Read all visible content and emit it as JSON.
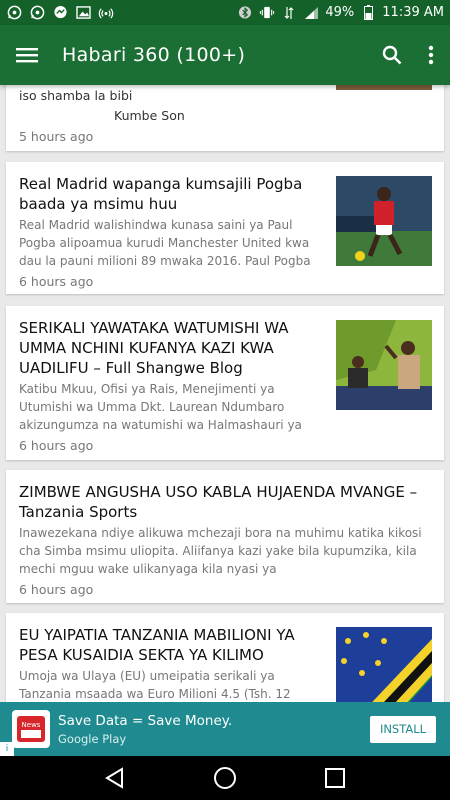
{
  "status_bar": {
    "left_icons": [
      "whatsapp-icon",
      "whatsapp-icon",
      "messenger-icon",
      "image-icon",
      "hotspot-icon"
    ],
    "battery": "49%",
    "time": "11:39 AM"
  },
  "app_bar": {
    "title": "Habari 360 (100+)",
    "menu_icon": "hamburger-menu-icon",
    "search_icon": "search-icon",
    "more_icon": "more-vert-icon"
  },
  "cards": [
    {
      "excerpt": "iso shamba la bibi",
      "excerpt2": "Kumbe Son",
      "time": "5 hours ago"
    },
    {
      "title": "Real Madrid wapanga kumsajili Pogba baada ya msimu huu",
      "excerpt": "Real Madrid walishindwa kunasa saini ya Paul Pogba alipoamua kurudi Manchester United kwa dau la pauni milioni 89 mwaka 2016. Paul Pogba",
      "time": "6 hours ago"
    },
    {
      "title": "SERIKALI YAWATAKA WATUMISHI WA UMMA NCHINI KUFANYA KAZI KWA UADILIFU – Full Shangwe Blog",
      "excerpt": "Katibu Mkuu, Ofisi ya Rais, Menejimenti ya Utumishi wa Umma Dkt. Laurean Ndumbaro akizungumza na watumishi wa Halmashauri ya",
      "time": "6 hours ago"
    },
    {
      "title": "ZIMBWE ANGUSHA USO KABLA HUJAENDA MVANGE – Tanzania Sports",
      "excerpt": "Inawezekana ndiye alikuwa mchezaji bora na muhimu katika kikosi cha Simba msimu uliopita. Aliifanya kazi yake bila kupumzika, kila mechi mguu wake ulikanyaga kila nyasi ya",
      "time": "6 hours ago"
    },
    {
      "title": "EU YAIPATIA TANZANIA MABILIONI YA PESA KUSAIDIA SEKTA YA KILIMO",
      "excerpt": "Umoja wa Ulaya (EU) umeipatia serikali ya Tanzania msaada wa Euro Milioni 4.5 (Tsh. 12"
    }
  ],
  "ad": {
    "headline": "Save Data = Save Money.",
    "source": "Google Play",
    "install_label": "INSTALL",
    "app_icon_text": "News"
  }
}
